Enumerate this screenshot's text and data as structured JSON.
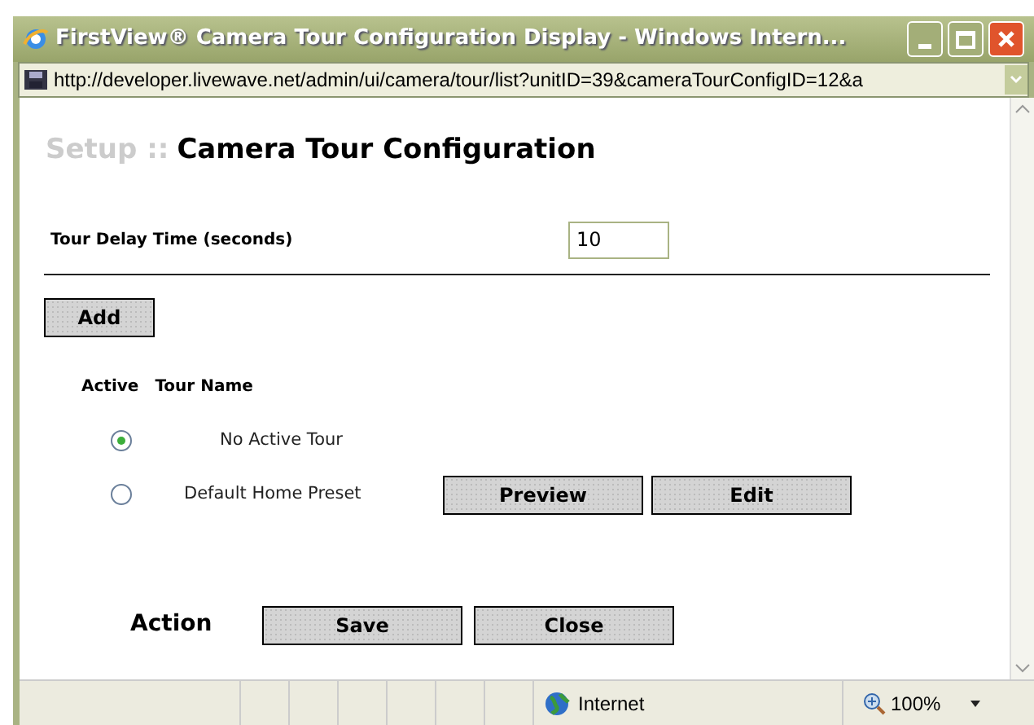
{
  "window": {
    "title": "FirstView® Camera Tour Configuration Display - Windows Intern..."
  },
  "address_bar": {
    "url": "http://developer.livewave.net/admin/ui/camera/tour/list?unitID=39&cameraTourConfigID=12&a"
  },
  "page": {
    "breadcrumb": "Setup ::",
    "heading": "Camera Tour Configuration",
    "delay": {
      "label": "Tour Delay Time (seconds)",
      "value": "10"
    },
    "add_button": "Add",
    "columns": [
      "Active",
      "Tour Name"
    ],
    "tours": [
      {
        "name": "No Active Tour",
        "selected": true
      },
      {
        "name": "Default Home Preset",
        "selected": false,
        "buttons": [
          "Preview",
          "Edit"
        ]
      }
    ],
    "action": {
      "label": "Action",
      "buttons": [
        "Save",
        "Close"
      ]
    }
  },
  "status_bar": {
    "zone": "Internet",
    "zoom": "100%"
  }
}
